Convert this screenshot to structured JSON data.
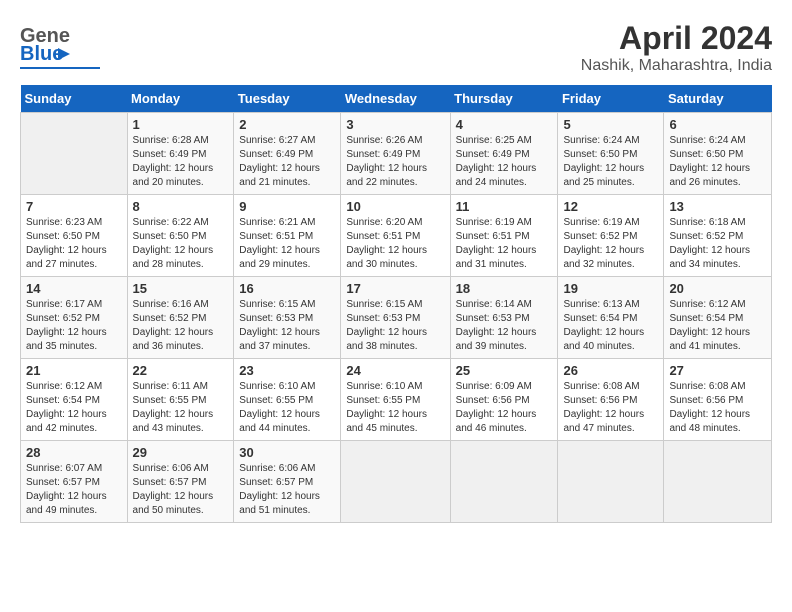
{
  "header": {
    "logo_general": "General",
    "logo_blue": "Blue",
    "title": "April 2024",
    "subtitle": "Nashik, Maharashtra, India"
  },
  "calendar": {
    "headers": [
      "Sunday",
      "Monday",
      "Tuesday",
      "Wednesday",
      "Thursday",
      "Friday",
      "Saturday"
    ],
    "weeks": [
      [
        {
          "day": "",
          "info": ""
        },
        {
          "day": "1",
          "info": "Sunrise: 6:28 AM\nSunset: 6:49 PM\nDaylight: 12 hours\nand 20 minutes."
        },
        {
          "day": "2",
          "info": "Sunrise: 6:27 AM\nSunset: 6:49 PM\nDaylight: 12 hours\nand 21 minutes."
        },
        {
          "day": "3",
          "info": "Sunrise: 6:26 AM\nSunset: 6:49 PM\nDaylight: 12 hours\nand 22 minutes."
        },
        {
          "day": "4",
          "info": "Sunrise: 6:25 AM\nSunset: 6:49 PM\nDaylight: 12 hours\nand 24 minutes."
        },
        {
          "day": "5",
          "info": "Sunrise: 6:24 AM\nSunset: 6:50 PM\nDaylight: 12 hours\nand 25 minutes."
        },
        {
          "day": "6",
          "info": "Sunrise: 6:24 AM\nSunset: 6:50 PM\nDaylight: 12 hours\nand 26 minutes."
        }
      ],
      [
        {
          "day": "7",
          "info": "Sunrise: 6:23 AM\nSunset: 6:50 PM\nDaylight: 12 hours\nand 27 minutes."
        },
        {
          "day": "8",
          "info": "Sunrise: 6:22 AM\nSunset: 6:50 PM\nDaylight: 12 hours\nand 28 minutes."
        },
        {
          "day": "9",
          "info": "Sunrise: 6:21 AM\nSunset: 6:51 PM\nDaylight: 12 hours\nand 29 minutes."
        },
        {
          "day": "10",
          "info": "Sunrise: 6:20 AM\nSunset: 6:51 PM\nDaylight: 12 hours\nand 30 minutes."
        },
        {
          "day": "11",
          "info": "Sunrise: 6:19 AM\nSunset: 6:51 PM\nDaylight: 12 hours\nand 31 minutes."
        },
        {
          "day": "12",
          "info": "Sunrise: 6:19 AM\nSunset: 6:52 PM\nDaylight: 12 hours\nand 32 minutes."
        },
        {
          "day": "13",
          "info": "Sunrise: 6:18 AM\nSunset: 6:52 PM\nDaylight: 12 hours\nand 34 minutes."
        }
      ],
      [
        {
          "day": "14",
          "info": "Sunrise: 6:17 AM\nSunset: 6:52 PM\nDaylight: 12 hours\nand 35 minutes."
        },
        {
          "day": "15",
          "info": "Sunrise: 6:16 AM\nSunset: 6:52 PM\nDaylight: 12 hours\nand 36 minutes."
        },
        {
          "day": "16",
          "info": "Sunrise: 6:15 AM\nSunset: 6:53 PM\nDaylight: 12 hours\nand 37 minutes."
        },
        {
          "day": "17",
          "info": "Sunrise: 6:15 AM\nSunset: 6:53 PM\nDaylight: 12 hours\nand 38 minutes."
        },
        {
          "day": "18",
          "info": "Sunrise: 6:14 AM\nSunset: 6:53 PM\nDaylight: 12 hours\nand 39 minutes."
        },
        {
          "day": "19",
          "info": "Sunrise: 6:13 AM\nSunset: 6:54 PM\nDaylight: 12 hours\nand 40 minutes."
        },
        {
          "day": "20",
          "info": "Sunrise: 6:12 AM\nSunset: 6:54 PM\nDaylight: 12 hours\nand 41 minutes."
        }
      ],
      [
        {
          "day": "21",
          "info": "Sunrise: 6:12 AM\nSunset: 6:54 PM\nDaylight: 12 hours\nand 42 minutes."
        },
        {
          "day": "22",
          "info": "Sunrise: 6:11 AM\nSunset: 6:55 PM\nDaylight: 12 hours\nand 43 minutes."
        },
        {
          "day": "23",
          "info": "Sunrise: 6:10 AM\nSunset: 6:55 PM\nDaylight: 12 hours\nand 44 minutes."
        },
        {
          "day": "24",
          "info": "Sunrise: 6:10 AM\nSunset: 6:55 PM\nDaylight: 12 hours\nand 45 minutes."
        },
        {
          "day": "25",
          "info": "Sunrise: 6:09 AM\nSunset: 6:56 PM\nDaylight: 12 hours\nand 46 minutes."
        },
        {
          "day": "26",
          "info": "Sunrise: 6:08 AM\nSunset: 6:56 PM\nDaylight: 12 hours\nand 47 minutes."
        },
        {
          "day": "27",
          "info": "Sunrise: 6:08 AM\nSunset: 6:56 PM\nDaylight: 12 hours\nand 48 minutes."
        }
      ],
      [
        {
          "day": "28",
          "info": "Sunrise: 6:07 AM\nSunset: 6:57 PM\nDaylight: 12 hours\nand 49 minutes."
        },
        {
          "day": "29",
          "info": "Sunrise: 6:06 AM\nSunset: 6:57 PM\nDaylight: 12 hours\nand 50 minutes."
        },
        {
          "day": "30",
          "info": "Sunrise: 6:06 AM\nSunset: 6:57 PM\nDaylight: 12 hours\nand 51 minutes."
        },
        {
          "day": "",
          "info": ""
        },
        {
          "day": "",
          "info": ""
        },
        {
          "day": "",
          "info": ""
        },
        {
          "day": "",
          "info": ""
        }
      ]
    ]
  }
}
